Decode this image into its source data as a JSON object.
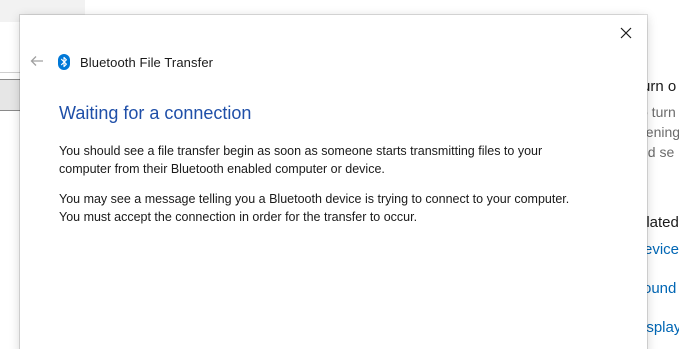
{
  "dialog": {
    "title": "Bluetooth File Transfer",
    "heading": "Waiting for a connection",
    "paragraphs": [
      "You should see a file transfer begin as soon as someone starts transmitting files to your computer from their Bluetooth enabled computer or device.",
      "You may see a message telling you a Bluetooth device is trying to connect to your computer. You must accept the connection in order for the transfer to occur."
    ],
    "icons": {
      "close": "close-icon",
      "back": "back-arrow-icon",
      "bluetooth": "bluetooth-icon"
    }
  },
  "background": {
    "right_fragments": [
      "urn o",
      "o turn",
      "pening",
      "nd se",
      "elated",
      "evice",
      "ound",
      "isplay"
    ]
  },
  "colors": {
    "heading": "#1f4fa8",
    "link": "#0066b4",
    "bluetooth": "#0078d7"
  }
}
